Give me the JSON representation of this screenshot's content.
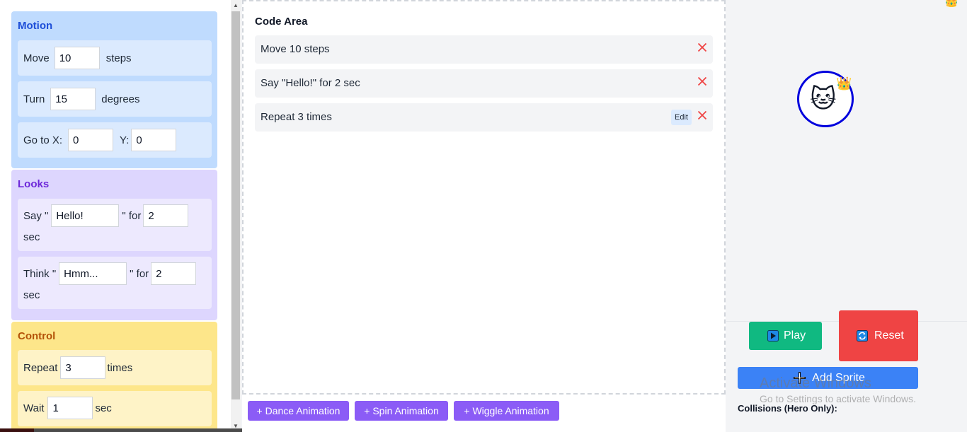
{
  "palette": {
    "motion": {
      "title": "Motion",
      "move": {
        "label": "Move",
        "value": "10",
        "unit": "steps"
      },
      "turn": {
        "label": "Turn",
        "value": "15",
        "unit": "degrees"
      },
      "goto": {
        "label_x": "Go to X:",
        "x": "0",
        "label_y": "Y:",
        "y": "0"
      }
    },
    "looks": {
      "title": "Looks",
      "say": {
        "prefix": "Say \"",
        "text": "Hello!",
        "mid": "\" for",
        "secs": "2",
        "unit": "sec"
      },
      "think": {
        "prefix": "Think \"",
        "text": "Hmm...",
        "mid": "\" for",
        "secs": "2",
        "unit": "sec"
      }
    },
    "control": {
      "title": "Control",
      "repeat": {
        "label": "Repeat",
        "value": "3",
        "unit": "times"
      },
      "wait": {
        "label": "Wait",
        "value": "1",
        "unit": "sec"
      }
    }
  },
  "code_area": {
    "title": "Code Area",
    "blocks": [
      {
        "label": "Move 10 steps"
      },
      {
        "label": "Say \"Hello!\" for 2 sec"
      },
      {
        "label": "Repeat 3 times",
        "edit": "Edit"
      }
    ]
  },
  "animations": [
    "+ Dance Animation",
    "+ Spin Animation",
    "+ Wiggle Animation"
  ],
  "stage": {
    "sprite_icon": "cat-face-icon",
    "crown_icon": "crown-icon",
    "play_label": "Play",
    "reset_label": "Reset",
    "add_sprite_label": "Add Sprite",
    "collisions_label": "Collisions (Hero Only):"
  },
  "watermark": {
    "line1": "Activate Windows",
    "line2": "Go to Settings to activate Windows."
  },
  "colors": {
    "motion": "#bfdbfe",
    "looks": "#ddd6fe",
    "control": "#fde68a",
    "play": "#10b981",
    "reset": "#ef4444",
    "add_sprite": "#3b82f6",
    "animation_button": "#8b5cf6",
    "sprite_ring": "#0000dd"
  }
}
